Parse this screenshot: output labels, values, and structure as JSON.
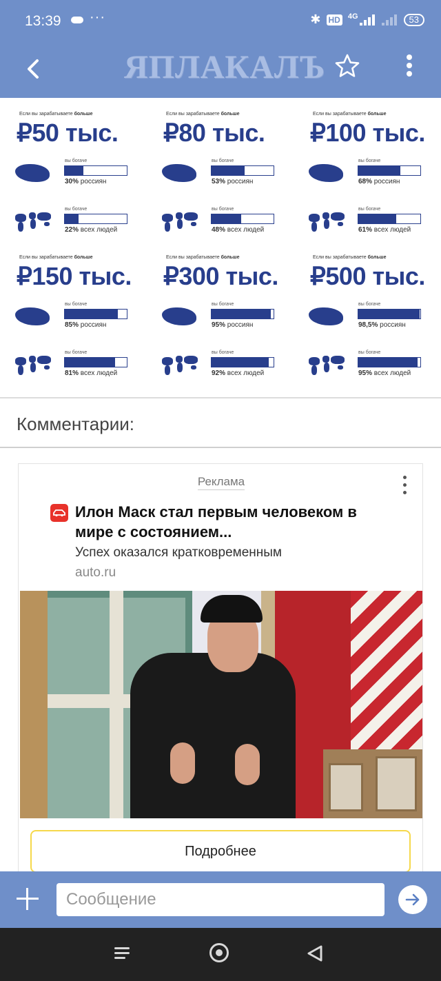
{
  "status": {
    "time": "13:39",
    "dots": "···",
    "hd": "HD",
    "net": "4G",
    "battery": "53"
  },
  "appbar": {
    "logo": "ЯПЛАКАЛЪ"
  },
  "infographic": {
    "caption_prefix": "Если вы зарабатываете ",
    "caption_bold": "больше",
    "richer_label": "вы богаче",
    "russians_suffix": " россиян",
    "people_suffix": " всех людей",
    "cells": [
      {
        "amount": "₽50 тыс.",
        "ru_pct": "30%",
        "ru_fill": 0.3,
        "world_pct": "22%",
        "world_fill": 0.22
      },
      {
        "amount": "₽80 тыс.",
        "ru_pct": "53%",
        "ru_fill": 0.53,
        "world_pct": "48%",
        "world_fill": 0.48
      },
      {
        "amount": "₽100 тыс.",
        "ru_pct": "68%",
        "ru_fill": 0.68,
        "world_pct": "61%",
        "world_fill": 0.61
      },
      {
        "amount": "₽150 тыс.",
        "ru_pct": "85%",
        "ru_fill": 0.85,
        "world_pct": "81%",
        "world_fill": 0.81
      },
      {
        "amount": "₽300 тыс.",
        "ru_pct": "95%",
        "ru_fill": 0.95,
        "world_pct": "92%",
        "world_fill": 0.92
      },
      {
        "amount": "₽500 тыс.",
        "ru_pct": "98,5%",
        "ru_fill": 0.985,
        "world_pct": "95%",
        "world_fill": 0.95
      }
    ]
  },
  "comments_heading": "Комментарии:",
  "ad": {
    "label": "Реклама",
    "title": "Илон Маск стал первым человеком в мире с состоянием...",
    "subtitle": "Успех оказался кратковременным",
    "domain": "auto.ru",
    "button": "Подробнее"
  },
  "composer": {
    "placeholder": "Сообщение"
  },
  "colors": {
    "accent": "#6f8fc9",
    "infographic_blue": "#283e8c",
    "ad_button_border": "#f6d84a"
  },
  "icons": [
    "cloud-icon",
    "bluetooth-icon",
    "back-icon",
    "star-icon",
    "more-icon",
    "car-icon",
    "plus-icon",
    "send-icon",
    "menu-icon",
    "home-icon",
    "nav-back-icon"
  ]
}
